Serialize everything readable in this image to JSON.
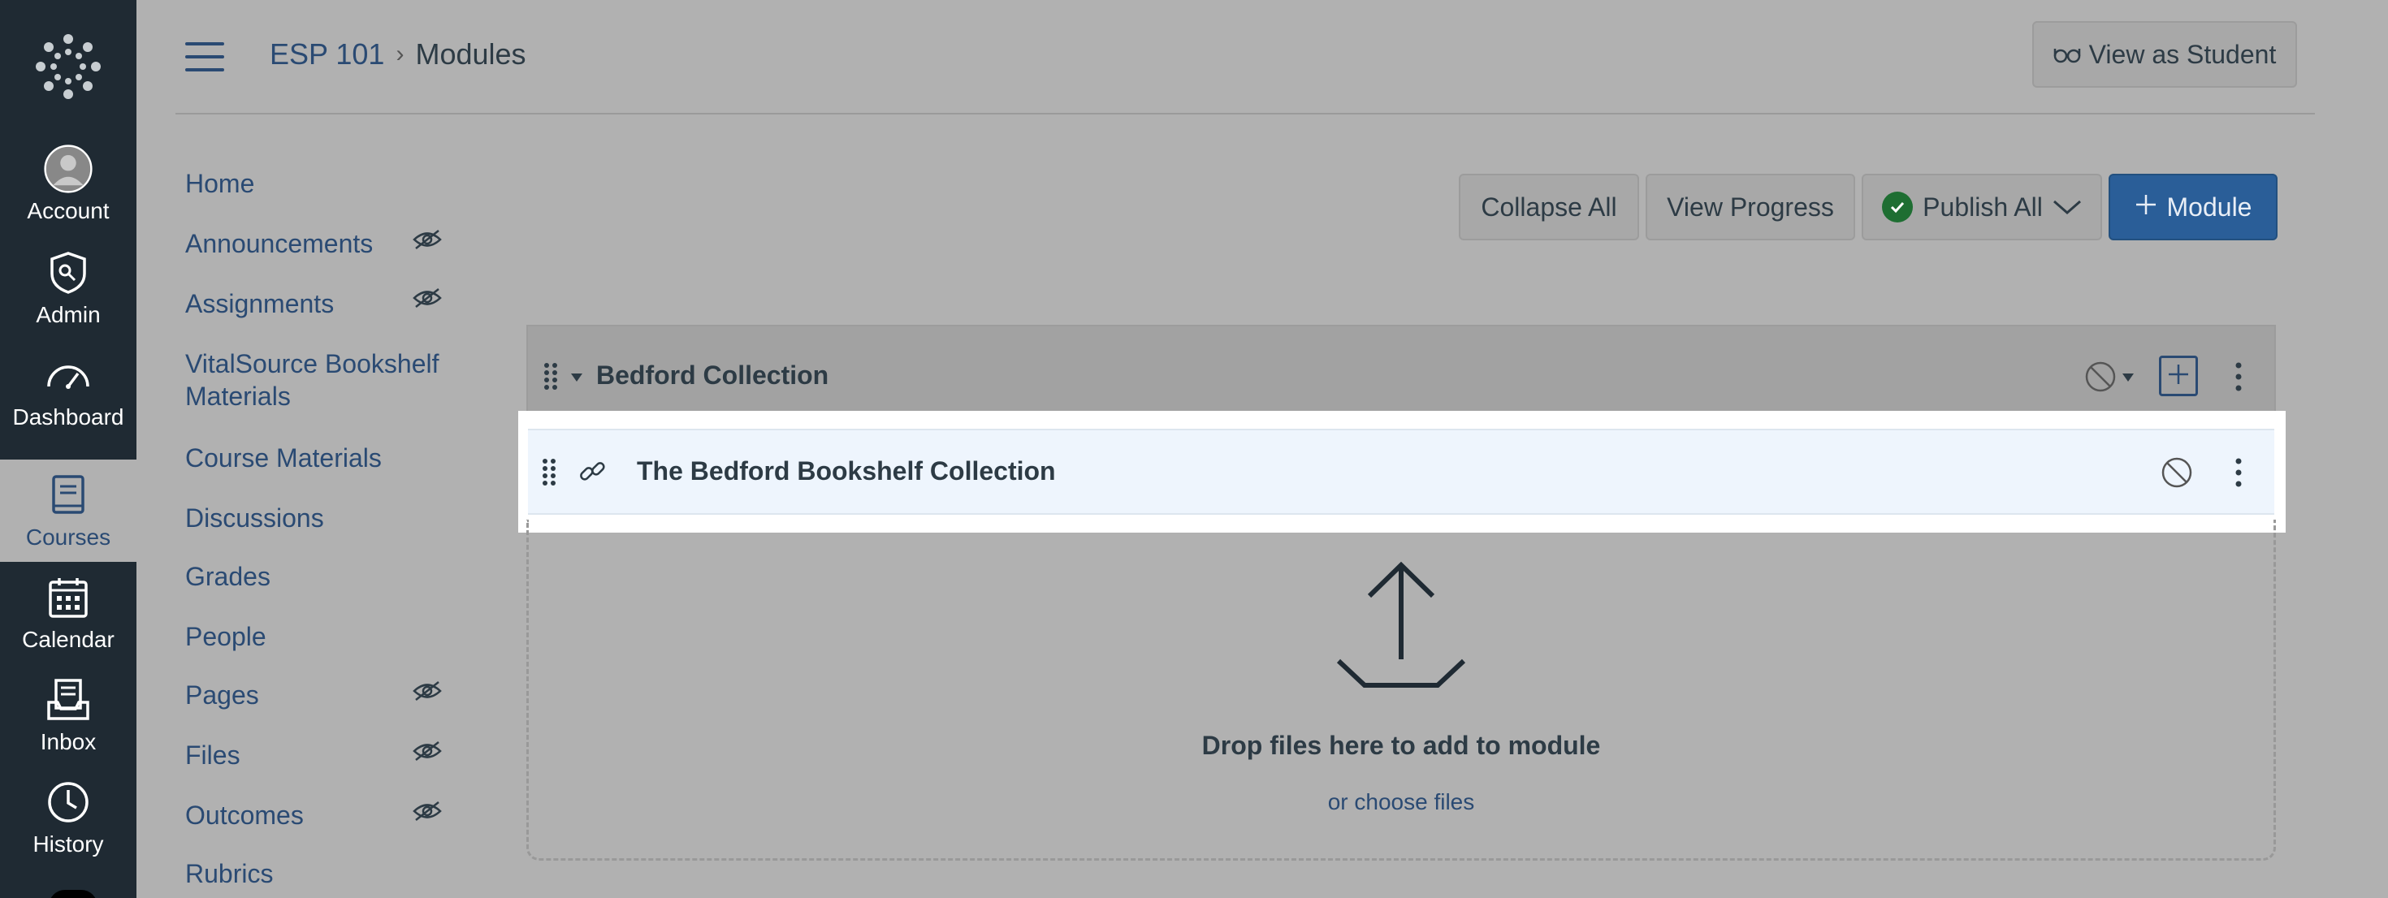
{
  "global_nav": {
    "items": [
      {
        "label": "Account",
        "icon": "avatar-icon"
      },
      {
        "label": "Admin",
        "icon": "shield-icon"
      },
      {
        "label": "Dashboard",
        "icon": "dashboard-icon"
      },
      {
        "label": "Courses",
        "icon": "book-icon",
        "active": true
      },
      {
        "label": "Calendar",
        "icon": "calendar-icon"
      },
      {
        "label": "Inbox",
        "icon": "inbox-icon"
      },
      {
        "label": "History",
        "icon": "clock-icon"
      }
    ]
  },
  "breadcrumb": {
    "course": "ESP 101",
    "separator": "›",
    "current": "Modules"
  },
  "header": {
    "view_as_student": "View as Student"
  },
  "course_nav": {
    "items": [
      {
        "label": "Home",
        "hidden": false
      },
      {
        "label": "Announcements",
        "hidden": true
      },
      {
        "label": "Assignments",
        "hidden": true
      },
      {
        "label": "VitalSource Bookshelf Materials",
        "hidden": false
      },
      {
        "label": "Course Materials",
        "hidden": false
      },
      {
        "label": "Discussions",
        "hidden": false
      },
      {
        "label": "Grades",
        "hidden": false
      },
      {
        "label": "People",
        "hidden": false
      },
      {
        "label": "Pages",
        "hidden": true
      },
      {
        "label": "Files",
        "hidden": true
      },
      {
        "label": "Outcomes",
        "hidden": true
      },
      {
        "label": "Rubrics",
        "hidden": false
      }
    ]
  },
  "toolbar": {
    "collapse_all": "Collapse All",
    "view_progress": "View Progress",
    "publish_all": "Publish All",
    "add_module": "Module"
  },
  "module": {
    "title": "Bedford Collection",
    "items": [
      {
        "title": "The Bedford Bookshelf Collection",
        "type": "link"
      }
    ]
  },
  "dropzone": {
    "main_text": "Drop files here to add to module",
    "link_text": "or choose files"
  },
  "colors": {
    "global_nav_bg": "#1f2a33",
    "link": "#2a4a73",
    "primary_button": "#2a5e98",
    "publish_check": "#1e6e32"
  }
}
